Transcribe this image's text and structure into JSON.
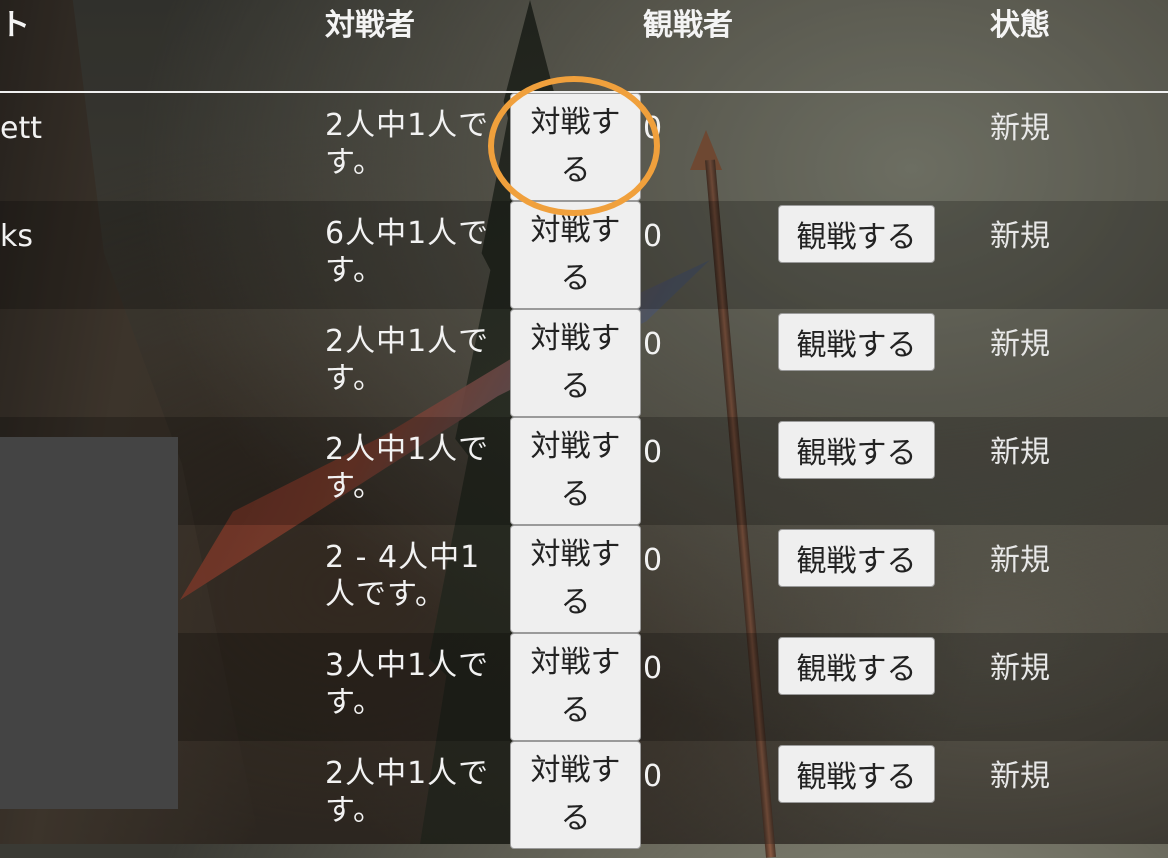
{
  "header": {
    "col_name": "ト",
    "col_players": "対戦者",
    "col_spectators": "観戦者",
    "col_status": "状態"
  },
  "colors": {
    "highlight": "#f0a03c",
    "button_bg": "#efefef"
  },
  "rows": [
    {
      "name": "ett",
      "players": "2人中1人です。",
      "join": "対戦する",
      "spectators": "0",
      "watch": "",
      "status": "新規"
    },
    {
      "name": "ks",
      "players": "6人中1人です。",
      "join": "対戦する",
      "spectators": "0",
      "watch": "観戦する",
      "status": "新規"
    },
    {
      "name": "",
      "players": "2人中1人です。",
      "join": "対戦する",
      "spectators": "0",
      "watch": "観戦する",
      "status": "新規"
    },
    {
      "name": "",
      "players": "2人中1人です。",
      "join": "対戦する",
      "spectators": "0",
      "watch": "観戦する",
      "status": "新規"
    },
    {
      "name": "",
      "players": "2 - 4人中1人です。",
      "join": "対戦する",
      "spectators": "0",
      "watch": "観戦する",
      "status": "新規"
    },
    {
      "name": "",
      "players": "3人中1人です。",
      "join": "対戦する",
      "spectators": "0",
      "watch": "観戦する",
      "status": "新規"
    },
    {
      "name": "",
      "players": "2人中1人です。",
      "join": "対戦する",
      "spectators": "0",
      "watch": "観戦する",
      "status": "新規"
    }
  ]
}
